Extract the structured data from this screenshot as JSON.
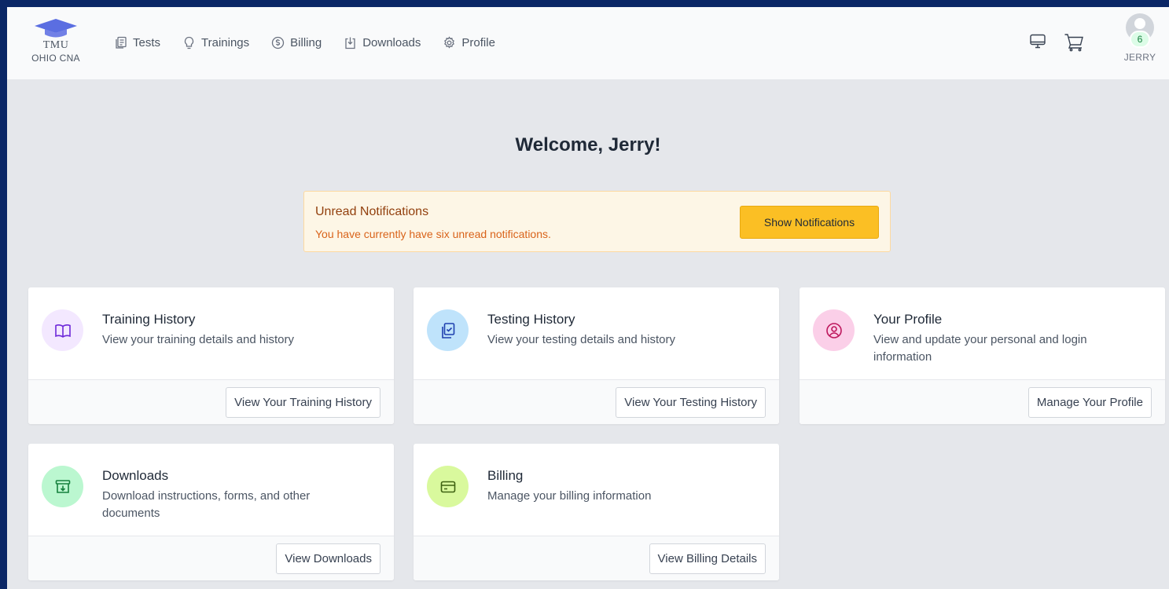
{
  "brand": {
    "name": "TMU",
    "subtitle": "OHIO CNA"
  },
  "nav": [
    {
      "label": "Tests",
      "icon": "tests-icon"
    },
    {
      "label": "Trainings",
      "icon": "lightbulb-icon"
    },
    {
      "label": "Billing",
      "icon": "dollar-icon"
    },
    {
      "label": "Downloads",
      "icon": "download-icon"
    },
    {
      "label": "Profile",
      "icon": "gear-icon"
    }
  ],
  "user": {
    "name": "JERRY",
    "badge": "6"
  },
  "welcome": "Welcome, Jerry!",
  "notification": {
    "title": "Unread Notifications",
    "text": "You have currently have six unread notifications.",
    "button": "Show Notifications"
  },
  "cards": [
    {
      "title": "Training History",
      "desc": "View your training details and history",
      "button": "View Your Training History",
      "icon": "book-icon",
      "color": "#f3e8ff"
    },
    {
      "title": "Testing History",
      "desc": "View your testing details and history",
      "button": "View Your Testing History",
      "icon": "clipboard-check-icon",
      "color": "#dbeafe"
    },
    {
      "title": "Your Profile",
      "desc": "View and update your personal and login information",
      "button": "Manage Your Profile",
      "icon": "user-circle-icon",
      "color": "#fce7f3"
    },
    {
      "title": "Downloads",
      "desc": "Download instructions, forms, and other documents",
      "button": "View Downloads",
      "icon": "archive-download-icon",
      "color": "#dcfce7"
    },
    {
      "title": "Billing",
      "desc": "Manage your billing information",
      "button": "View Billing Details",
      "icon": "credit-card-icon",
      "color": "#ecfccb"
    }
  ]
}
